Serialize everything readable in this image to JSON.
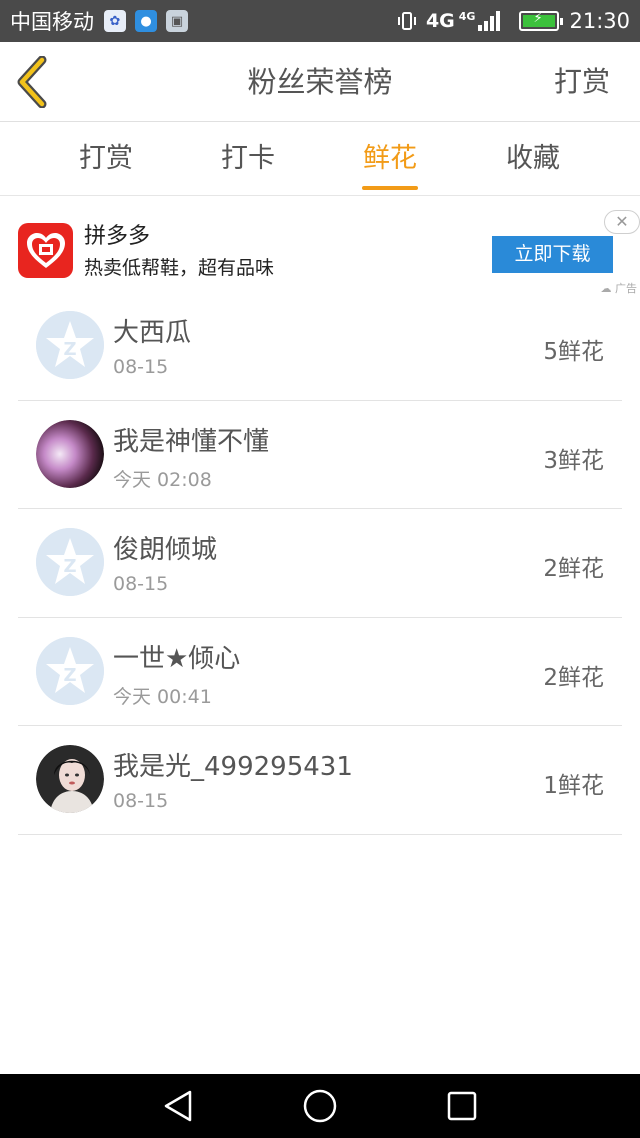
{
  "status_bar": {
    "carrier": "中国移动",
    "network": "4G",
    "network2": "4G",
    "time": "21:30"
  },
  "header": {
    "title": "粉丝荣誉榜",
    "action": "打赏"
  },
  "tabs": [
    {
      "label": "打赏"
    },
    {
      "label": "打卡"
    },
    {
      "label": "鲜花",
      "active": true
    },
    {
      "label": "收藏"
    }
  ],
  "ad": {
    "title": "拼多多",
    "description": "热卖低帮鞋，超有品味",
    "button": "立即下载",
    "label": "广告"
  },
  "fans": [
    {
      "name": "大西瓜",
      "date": "08-15",
      "count": "5鲜花",
      "avatar": "default-avatar"
    },
    {
      "name": "我是神懂不懂",
      "date": "今天 02:08",
      "count": "3鲜花",
      "avatar": "photo-avatar"
    },
    {
      "name": "俊朗倾城",
      "date": "08-15",
      "count": "2鲜花",
      "avatar": "default-avatar"
    },
    {
      "name": "一世★倾心",
      "date": "今天 00:41",
      "count": "2鲜花",
      "avatar": "default-avatar"
    },
    {
      "name": "我是光_499295431",
      "date": "08-15",
      "count": "1鲜花",
      "avatar": "photo-avatar"
    }
  ],
  "colors": {
    "accent": "#f29b17",
    "ad_button": "#2a8ad8",
    "status_bar": "#4a4a4a"
  }
}
